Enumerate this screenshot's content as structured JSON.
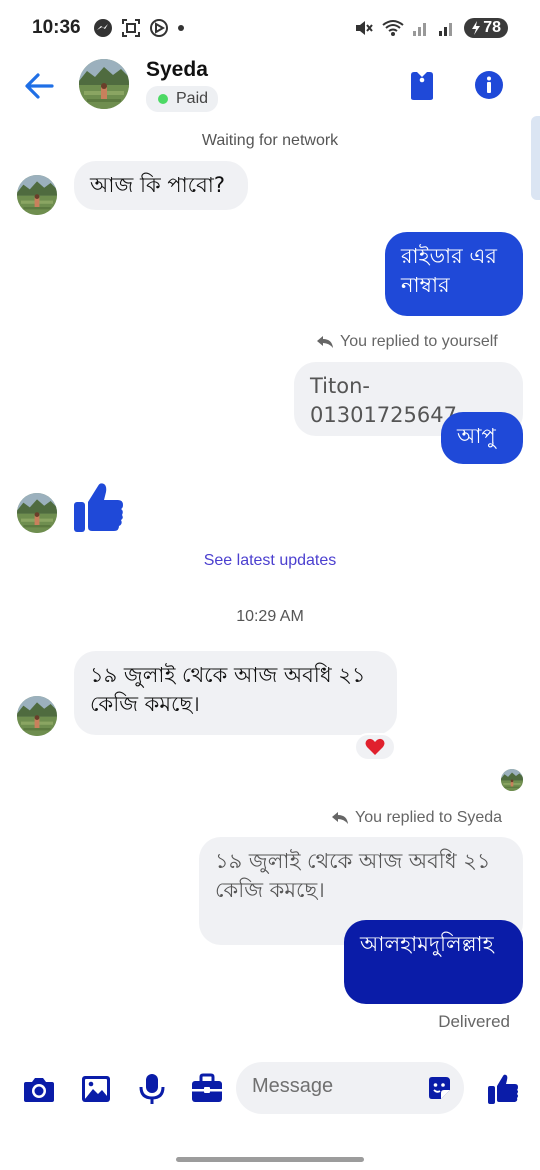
{
  "status_bar": {
    "time": "10:36",
    "battery": "78"
  },
  "header": {
    "name": "Syeda",
    "badge": "Paid"
  },
  "messages": {
    "waiting": "Waiting for network",
    "m1": "আজ কি পাবো?",
    "m2": "রাইডার এর নাম্বার",
    "reply_note_1": "You replied to yourself",
    "quote_1": "Titon-01301725647",
    "m3": "আপু",
    "see_latest": "See latest updates",
    "time_sep": "10:29 AM",
    "m4": "১৯ জুলাই থেকে আজ অবধি  ২১ কেজি কমছে।",
    "reply_note_2": "You replied to Syeda",
    "quote_2": "১৯ জুলাই থেকে আজ অবধি  ২১ কেজি কমছে।",
    "m5": "আলহামদুলিল্লাহ",
    "delivered": "Delivered"
  },
  "composer": {
    "placeholder": "Message"
  },
  "icons": {
    "status": [
      "messenger-icon",
      "screenshot-icon",
      "assistant-icon",
      "dot-icon",
      "mute-icon",
      "wifi-icon",
      "signal-icon",
      "battery-icon"
    ],
    "header": [
      "back-arrow-icon",
      "tag-icon",
      "info-icon"
    ],
    "composer": [
      "camera-icon",
      "gallery-icon",
      "microphone-icon",
      "briefcase-icon",
      "sticker-icon",
      "thumbs-up-icon"
    ]
  },
  "colors": {
    "accent": "#1f49d8",
    "dark_bubble": "#0a1ca8",
    "incoming_bubble": "#f0f1f4",
    "link": "#4b3fcf",
    "online": "#4cd964"
  }
}
